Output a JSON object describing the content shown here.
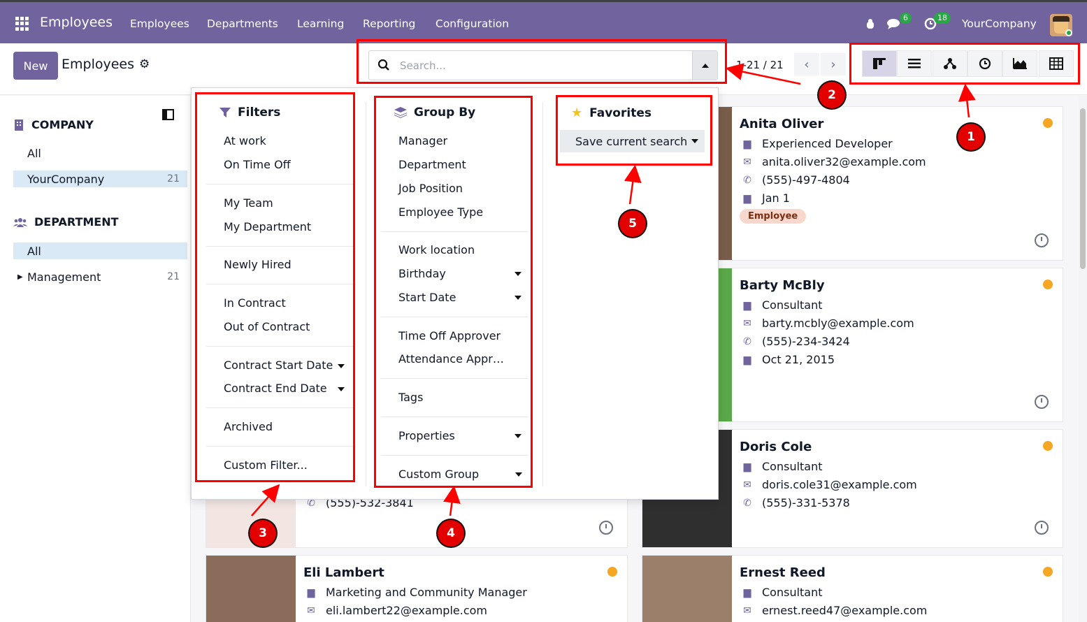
{
  "topbar": {
    "app_title": "Employees",
    "nav": [
      "Employees",
      "Departments",
      "Learning",
      "Reporting",
      "Configuration"
    ],
    "messages_count": "6",
    "activities_count": "18",
    "company": "YourCompany"
  },
  "control": {
    "new_label": "New",
    "title": "Employees",
    "search_placeholder": "Search...",
    "pager": "1-21 / 21"
  },
  "sidebar": {
    "company_heading": "COMPANY",
    "company_items": [
      {
        "label": "All",
        "count": ""
      },
      {
        "label": "YourCompany",
        "count": "21"
      }
    ],
    "department_heading": "DEPARTMENT",
    "department_items": [
      {
        "label": "All",
        "count": ""
      },
      {
        "label": "Management",
        "count": "21"
      }
    ]
  },
  "dropdown": {
    "filters_heading": "Filters",
    "filters": [
      "At work",
      "On Time Off",
      "My Team",
      "My Department",
      "Newly Hired",
      "In Contract",
      "Out of Contract",
      "Contract Start Date",
      "Contract End Date",
      "Archived",
      "Custom Filter..."
    ],
    "groupby_heading": "Group By",
    "groupby": [
      "Manager",
      "Department",
      "Job Position",
      "Employee Type",
      "Work location",
      "Birthday",
      "Start Date",
      "Time Off Approver",
      "Attendance Appr…",
      "Tags",
      "Properties",
      "Custom Group"
    ],
    "favorites_heading": "Favorites",
    "save_search": "Save current search"
  },
  "cards": [
    {
      "name": "Anita Oliver",
      "job": "Experienced Developer",
      "email": "anita.oliver32@example.com",
      "phone": "(555)-497-4804",
      "date": "Jan 1",
      "tag": "Employee"
    },
    {
      "name": "Barty McBly",
      "job": "Consultant",
      "email": "barty.mcbly@example.com",
      "phone": "(555)-234-3424",
      "date": "Oct 21, 2015"
    },
    {
      "name": "Doris Cole",
      "job": "Consultant",
      "email": "doris.cole31@example.com",
      "phone": "(555)-331-5378"
    },
    {
      "name": "Eli Lambert",
      "job": "Marketing and Community Manager",
      "email": "eli.lambert22@example.com"
    },
    {
      "name": "Ernest Reed",
      "job": "Consultant",
      "email": "ernest.reed47@example.com"
    },
    {
      "phone": "(555)-532-3841"
    }
  ],
  "annotations": [
    "1",
    "2",
    "3",
    "4",
    "5"
  ],
  "colors": {
    "brand": "#71639e",
    "annotation": "#ff0000",
    "status_away": "#f5a623"
  }
}
